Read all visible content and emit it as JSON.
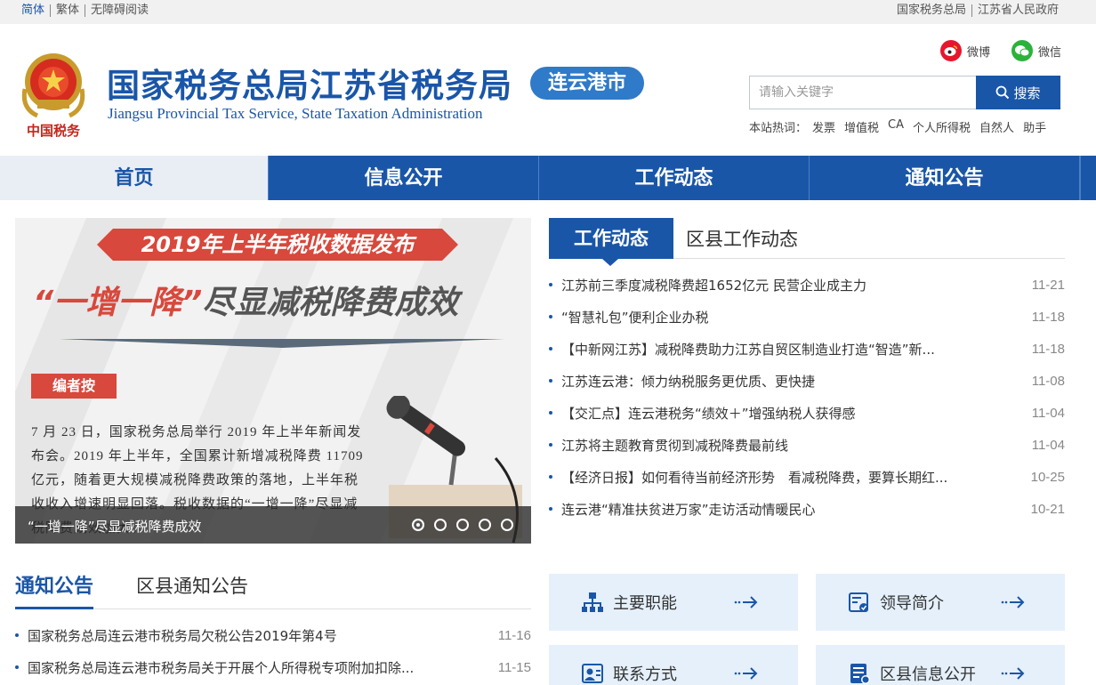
{
  "topbar": {
    "left_links": [
      "简体",
      "繁体",
      "无障碍阅读"
    ],
    "right_links": [
      "国家税务总局",
      "江苏省人民政府"
    ]
  },
  "header": {
    "title": "国家税务总局江苏省税务局",
    "subtitle": "Jiangsu Provincial Tax Service, State Taxation Administration",
    "city": "连云港市",
    "emblem_text": "中国税务",
    "social": {
      "weibo": "微博",
      "weixin": "微信"
    }
  },
  "search": {
    "placeholder": "请输入关键字",
    "button": "搜索",
    "hot_label": "本站热词：",
    "hot_words": [
      "发票",
      "增值税",
      "CA",
      "个人所得税",
      "自然人",
      "助手"
    ]
  },
  "nav": [
    "首页",
    "信息公开",
    "工作动态",
    "通知公告"
  ],
  "banner": {
    "headline": "2019年上半年税收数据发布",
    "slogan_quote": "“一增一降”",
    "slogan_rest": "尽显减税降费成效",
    "editor_tag": "编者按",
    "body": "7 月 23 日，国家税务总局举行 2019 年上半年新闻发布会。2019 年上半年，全国累计新增减税降费 11709 亿元，随着更大规模减税降费政策的落地，上半年税收收入增速明显回落。税收数据的“一增一降”尽显减税降费成效加大。",
    "caption": "“一增一降”尽显减税降费成效",
    "slide_count": 5,
    "active_slide": 1
  },
  "work_news": {
    "tab_active": "工作动态",
    "tab_other": "区县工作动态",
    "items": [
      {
        "title": "江苏前三季度减税降费超1652亿元 民营企业成主力",
        "date": "11-21"
      },
      {
        "title": "“智慧礼包”便利企业办税",
        "date": "11-18"
      },
      {
        "title": "【中新网江苏】减税降费助力江苏自贸区制造业打造“智造”新...",
        "date": "11-18"
      },
      {
        "title": "江苏连云港：倾力纳税服务更优质、更快捷",
        "date": "11-08"
      },
      {
        "title": "【交汇点】连云港税务“绩效＋”增强纳税人获得感",
        "date": "11-04"
      },
      {
        "title": "江苏将主题教育贯彻到减税降费最前线",
        "date": "11-04"
      },
      {
        "title": "【经济日报】如何看待当前经济形势　看减税降费，要算长期红...",
        "date": "10-25"
      },
      {
        "title": "连云港“精准扶贫进万家”走访活动情暖民心",
        "date": "10-21"
      }
    ]
  },
  "notices": {
    "tab_active": "通知公告",
    "tab_other": "区县通知公告",
    "items": [
      {
        "title": "国家税务总局连云港市税务局欠税公告2019年第4号",
        "date": "11-16"
      },
      {
        "title": "国家税务总局连云港市税务局关于开展个人所得税专项附加扣除...",
        "date": "11-15"
      }
    ]
  },
  "quick_links": [
    {
      "label": "主要职能",
      "icon": "org-chart-icon"
    },
    {
      "label": "领导简介",
      "icon": "profile-card-icon"
    },
    {
      "label": "联系方式",
      "icon": "contact-icon"
    },
    {
      "label": "区县信息公开",
      "icon": "document-icon"
    }
  ],
  "colors": {
    "brand_blue": "#1a56a8",
    "badge_blue": "#2f7ac9",
    "banner_red": "#d8483c",
    "quick_bg": "#e5f0fb"
  }
}
